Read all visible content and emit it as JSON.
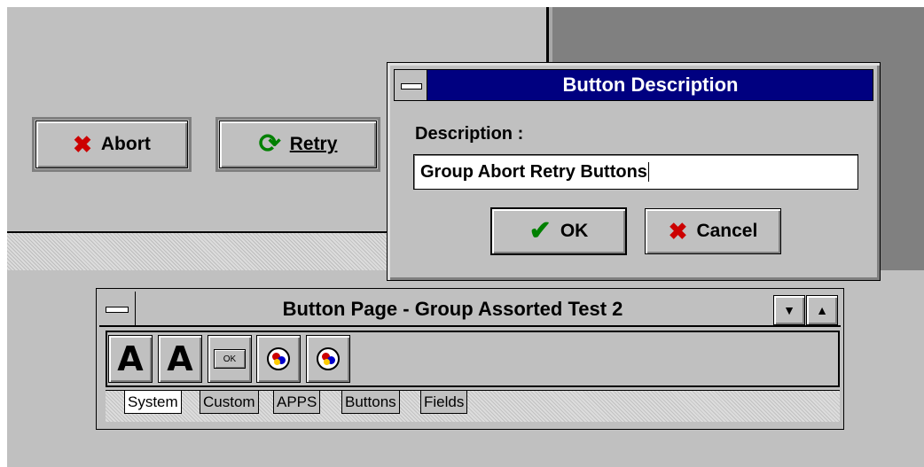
{
  "form_buttons": {
    "abort": {
      "label": "Abort",
      "icon": "x-icon"
    },
    "retry": {
      "label": "Retry",
      "icon": "refresh-icon"
    }
  },
  "dialog": {
    "title": "Button Description",
    "description_label": "Description :",
    "description_value": "Group Abort Retry Buttons",
    "ok_label": "OK",
    "cancel_label": "Cancel"
  },
  "toolbox": {
    "title": "Button Page - Group Assorted Test 2",
    "tools": [
      {
        "name": "text-label-tool",
        "glyph": "A"
      },
      {
        "name": "text-field-tool",
        "glyph": "A"
      },
      {
        "name": "button-tool",
        "glyph": "OK"
      },
      {
        "name": "group-tool-1",
        "glyph": "shapes"
      },
      {
        "name": "group-tool-2",
        "glyph": "shapes"
      }
    ],
    "tabs": [
      "System",
      "Custom",
      "APPS",
      "Buttons",
      "Fields"
    ],
    "active_tab": "System"
  },
  "colors": {
    "titlebar": "#000080",
    "face": "#c0c0c0",
    "desktop": "#808080",
    "abort_red": "#cc0000",
    "retry_green": "#008000"
  }
}
